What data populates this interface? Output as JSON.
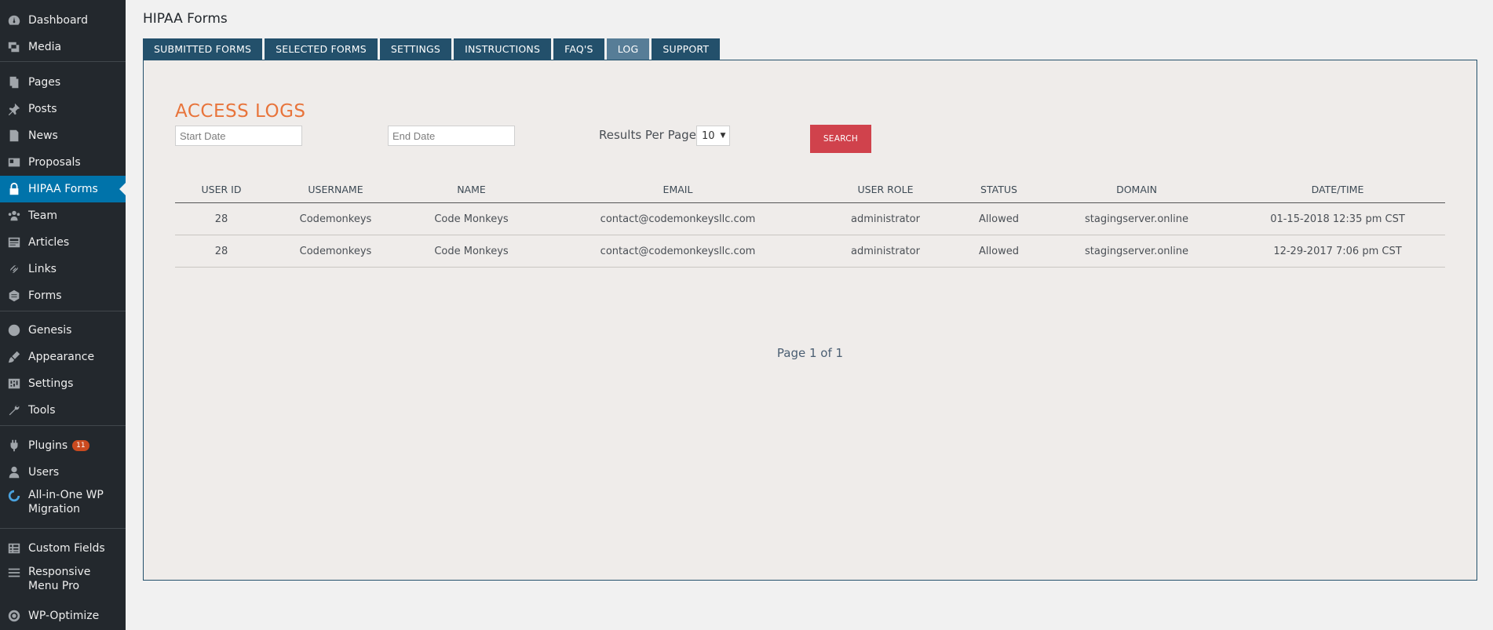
{
  "sidebar": {
    "items": [
      {
        "label": "Dashboard",
        "icon": "dashboard-icon"
      },
      {
        "label": "Media",
        "icon": "media-icon"
      },
      {
        "label": "Pages",
        "icon": "pages-icon"
      },
      {
        "label": "Posts",
        "icon": "pin-icon"
      },
      {
        "label": "News",
        "icon": "document-icon"
      },
      {
        "label": "Proposals",
        "icon": "id-card-icon"
      },
      {
        "label": "HIPAA Forms",
        "icon": "lock-icon"
      },
      {
        "label": "Team",
        "icon": "groups-icon"
      },
      {
        "label": "Articles",
        "icon": "articles-icon"
      },
      {
        "label": "Links",
        "icon": "link-icon"
      },
      {
        "label": "Forms",
        "icon": "forms-icon"
      },
      {
        "label": "Genesis",
        "icon": "genesis-icon"
      },
      {
        "label": "Appearance",
        "icon": "brush-icon"
      },
      {
        "label": "Settings",
        "icon": "settings-icon"
      },
      {
        "label": "Tools",
        "icon": "wrench-icon"
      },
      {
        "label": "Plugins",
        "icon": "plugin-icon",
        "badge": "11"
      },
      {
        "label": "Users",
        "icon": "user-icon"
      },
      {
        "label": "All-in-One WP Migration",
        "icon": "migration-icon"
      },
      {
        "label": "Custom Fields",
        "icon": "table-icon"
      },
      {
        "label": "Responsive Menu Pro",
        "icon": "hamburger-icon"
      },
      {
        "label": "WP-Optimize",
        "icon": "optimize-icon"
      }
    ]
  },
  "header": {
    "title": "HIPAA Forms"
  },
  "tabs": [
    {
      "label": "SUBMITTED FORMS"
    },
    {
      "label": "SELECTED FORMS"
    },
    {
      "label": "SETTINGS"
    },
    {
      "label": "INSTRUCTIONS"
    },
    {
      "label": "FAQ'S"
    },
    {
      "label": "LOG"
    },
    {
      "label": "SUPPORT"
    }
  ],
  "logs": {
    "title": "ACCESS LOGS",
    "start_placeholder": "Start Date",
    "end_placeholder": "End Date",
    "results_label": "Results Per Page:",
    "results_value": "10",
    "search_label": "SEARCH",
    "columns": [
      "USER ID",
      "USERNAME",
      "NAME",
      "EMAIL",
      "USER ROLE",
      "STATUS",
      "DOMAIN",
      "DATE/TIME"
    ],
    "rows": [
      [
        "28",
        "Codemonkeys",
        "Code Monkeys",
        "contact@codemonkeysllc.com",
        "administrator",
        "Allowed",
        "stagingserver.online",
        "01-15-2018 12:35 pm CST"
      ],
      [
        "28",
        "Codemonkeys",
        "Code Monkeys",
        "contact@codemonkeysllc.com",
        "administrator",
        "Allowed",
        "stagingserver.online",
        "12-29-2017 7:06 pm CST"
      ]
    ],
    "pagination": "Page 1 of 1"
  },
  "colors": {
    "sidebar_bg": "#23282d",
    "active_menu": "#0073aa",
    "tab_bg": "#23506b",
    "tab_active": "#577d97",
    "title_orange": "#e8743b",
    "search_red": "#d0424c"
  }
}
